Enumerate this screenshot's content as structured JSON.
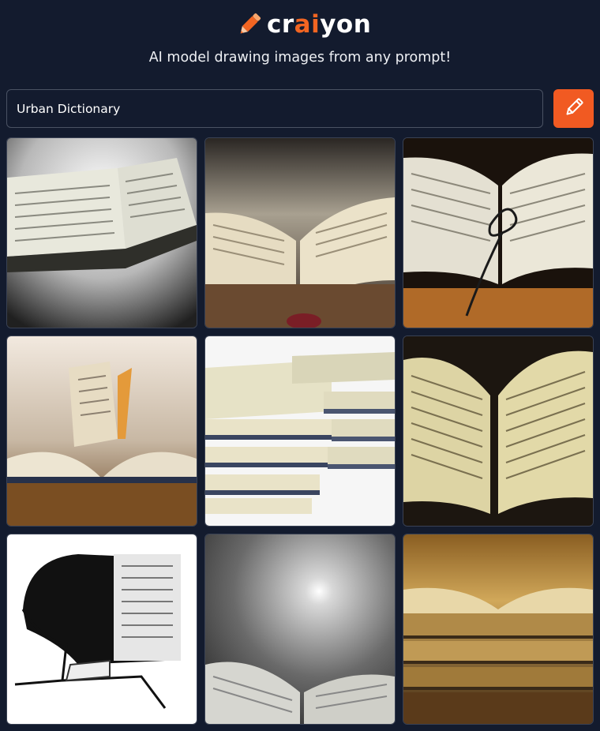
{
  "app": {
    "logo_prefix": "cr",
    "logo_accent": "ai",
    "logo_suffix": "yon",
    "tagline": "AI model drawing images from any prompt!",
    "brand_color": "#f26522",
    "background_color": "#131b2e"
  },
  "search": {
    "value": "Urban Dictionary",
    "draw_button_icon": "pencil-icon"
  },
  "results": [
    {
      "name": "open book on bright surface"
    },
    {
      "name": "open book with spotlight"
    },
    {
      "name": "open dictionary with glasses"
    },
    {
      "name": "open book with standing pages"
    },
    {
      "name": "stack of books"
    },
    {
      "name": "open book with yellowed pages"
    },
    {
      "name": "black and white book illustration"
    },
    {
      "name": "book under dim light"
    },
    {
      "name": "stack of old books"
    }
  ]
}
